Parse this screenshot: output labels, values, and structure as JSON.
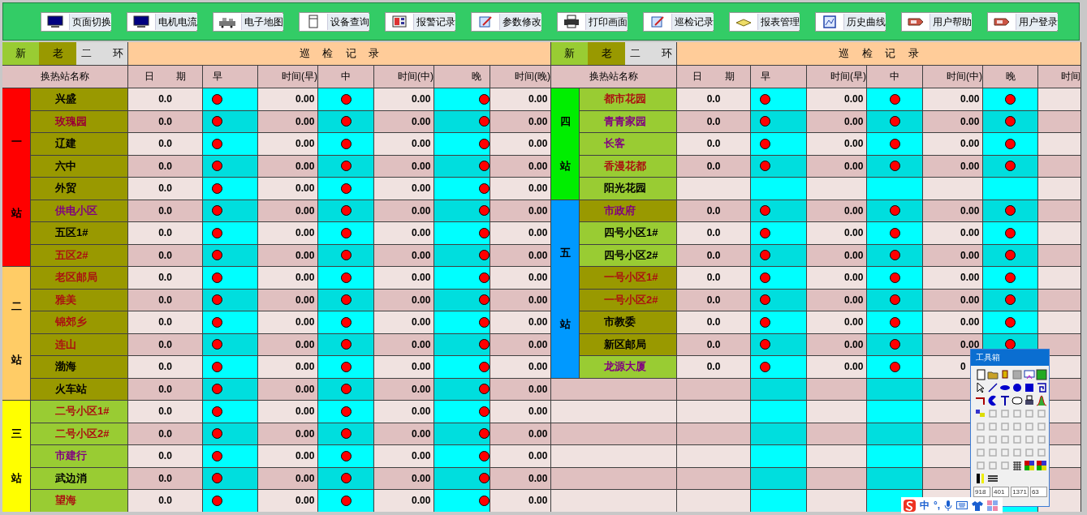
{
  "toolbar": {
    "buttons": [
      {
        "label": "页面切换"
      },
      {
        "label": "电机电流"
      },
      {
        "label": "电子地图"
      },
      {
        "label": "设备查询"
      },
      {
        "label": "报警记录"
      },
      {
        "label": "参数修改"
      },
      {
        "label": "打印画面"
      },
      {
        "label": "巡检记录"
      },
      {
        "label": "报表管理"
      },
      {
        "label": "历史曲线"
      },
      {
        "label": "用户帮助"
      },
      {
        "label": "用户登录"
      }
    ]
  },
  "panels": [
    {
      "tabs": [
        {
          "label": "新",
          "color": "#99cc33"
        },
        {
          "label": "老",
          "color": "#999900"
        },
        {
          "label": "二 环",
          "color": "#dcdcdc"
        }
      ],
      "title": "巡 检 记 录",
      "columns": [
        "换热站名称",
        "日 期",
        "早",
        "时间(早)",
        "中",
        "时间(中)",
        "晚",
        "时间(晚)"
      ],
      "groups": [
        {
          "kind": "station",
          "label": "一站",
          "color": "#ff0000",
          "rows": [
            {
              "name": "兴盛",
              "color": "#000000",
              "kind": "old",
              "date": "0.0",
              "times": [
                "0.00",
                "0.00",
                "0.00"
              ],
              "dots": [
                {
                  "color": "#ff0000"
                },
                {
                  "color": "#ff0000"
                },
                {
                  "color": "#ff0000"
                }
              ]
            },
            {
              "name": "玫瑰园",
              "color": "#990033",
              "kind": "old",
              "date": "0.0",
              "times": [
                "0.00",
                "0.00",
                "0.00"
              ],
              "dots": [
                {
                  "color": "#ff0000"
                },
                {
                  "color": "#ff0000"
                },
                {
                  "color": "#ff0000"
                }
              ]
            },
            {
              "name": "辽建",
              "color": "#000000",
              "kind": "old",
              "date": "0.0",
              "times": [
                "0.00",
                "0.00",
                "0.00"
              ],
              "dots": [
                {
                  "color": "#ff0000"
                },
                {
                  "color": "#ff0000"
                },
                {
                  "color": "#ff0000"
                }
              ]
            },
            {
              "name": "六中",
              "color": "#000000",
              "kind": "old",
              "date": "0.0",
              "times": [
                "0.00",
                "0.00",
                "0.00"
              ],
              "dots": [
                {
                  "color": "#ff0000"
                },
                {
                  "color": "#ff0000"
                },
                {
                  "color": "#ff0000"
                }
              ]
            },
            {
              "name": "外贸",
              "color": "#000000",
              "kind": "old",
              "date": "0.0",
              "times": [
                "0.00",
                "0.00",
                "0.00"
              ],
              "dots": [
                {
                  "color": "#ff0000"
                },
                {
                  "color": "#ff0000"
                },
                {
                  "color": "#ff0000"
                }
              ]
            },
            {
              "name": "供电小区",
              "color": "#800080",
              "kind": "old",
              "date": "0.0",
              "times": [
                "0.00",
                "0.00",
                "0.00"
              ],
              "dots": [
                {
                  "color": "#ff0000"
                },
                {
                  "color": "#ff0000"
                },
                {
                  "color": "#ff0000"
                }
              ]
            },
            {
              "name": "五区1#",
              "color": "#000000",
              "kind": "old",
              "date": "0.0",
              "times": [
                "0.00",
                "0.00",
                "0.00"
              ],
              "dots": [
                {
                  "color": "#ff0000"
                },
                {
                  "color": "#ff0000"
                },
                {
                  "color": "#ff0000"
                }
              ]
            },
            {
              "name": "五区2#",
              "color": "#aa1111",
              "kind": "old",
              "date": "0.0",
              "times": [
                "0.00",
                "0.00",
                "0.00"
              ],
              "dots": [
                {
                  "color": "#ff0000"
                },
                {
                  "color": "#ff0000"
                },
                {
                  "color": "#ff0000"
                }
              ]
            }
          ]
        },
        {
          "kind": "station",
          "label": "二站",
          "color": "#ffcc66",
          "rows": [
            {
              "name": "老区邮局",
              "color": "#aa1111",
              "kind": "old",
              "date": "0.0",
              "times": [
                "0.00",
                "0.00",
                "0.00"
              ],
              "dots": [
                {
                  "color": "#ff0000"
                },
                {
                  "color": "#ff0000"
                },
                {
                  "color": "#ff0000"
                }
              ]
            },
            {
              "name": "雅美",
              "color": "#aa1111",
              "kind": "old",
              "date": "0.0",
              "times": [
                "0.00",
                "0.00",
                "0.00"
              ],
              "dots": [
                {
                  "color": "#ff0000"
                },
                {
                  "color": "#ff0000"
                },
                {
                  "color": "#ff0000"
                }
              ]
            },
            {
              "name": "锦郊乡",
              "color": "#aa1111",
              "kind": "old",
              "date": "0.0",
              "times": [
                "0.00",
                "0.00",
                "0.00"
              ],
              "dots": [
                {
                  "color": "#ff0000"
                },
                {
                  "color": "#ff0000"
                },
                {
                  "color": "#ff0000"
                }
              ]
            },
            {
              "name": "连山",
              "color": "#aa1111",
              "kind": "old",
              "date": "0.0",
              "times": [
                "0.00",
                "0.00",
                "0.00"
              ],
              "dots": [
                {
                  "color": "#ff0000"
                },
                {
                  "color": "#ff0000"
                },
                {
                  "color": "#ff0000"
                }
              ]
            },
            {
              "name": "渤海",
              "color": "#000000",
              "kind": "old",
              "date": "0.0",
              "times": [
                "0.00",
                "0.00",
                "0.00"
              ],
              "dots": [
                {
                  "color": "#ff0000"
                },
                {
                  "color": "#ff0000"
                },
                {
                  "color": "#ff0000"
                }
              ]
            },
            {
              "name": "火车站",
              "color": "#000000",
              "kind": "old",
              "date": "0.0",
              "times": [
                "0.00",
                "0.00",
                "0.00"
              ],
              "dots": [
                {
                  "color": "#ff0000"
                },
                {
                  "color": "#ff0000"
                },
                {
                  "color": "#ff0000"
                }
              ]
            }
          ]
        },
        {
          "kind": "station",
          "label": "三站",
          "color": "#ffff00",
          "rows": [
            {
              "name": "二号小区1#",
              "color": "#aa1111",
              "kind": "new",
              "date": "0.0",
              "times": [
                "0.00",
                "0.00",
                "0.00"
              ],
              "dots": [
                {
                  "color": "#ff0000"
                },
                {
                  "color": "#ff0000"
                },
                {
                  "color": "#ff0000"
                }
              ]
            },
            {
              "name": "二号小区2#",
              "color": "#aa1111",
              "kind": "new",
              "date": "0.0",
              "times": [
                "0.00",
                "0.00",
                "0.00"
              ],
              "dots": [
                {
                  "color": "#ff0000"
                },
                {
                  "color": "#ff0000"
                },
                {
                  "color": "#ff0000"
                }
              ]
            },
            {
              "name": "市建行",
              "color": "#800080",
              "kind": "new",
              "date": "0.0",
              "times": [
                "0.00",
                "0.00",
                "0.00"
              ],
              "dots": [
                {
                  "color": "#ff0000"
                },
                {
                  "color": "#ff0000"
                },
                {
                  "color": "#ff0000"
                }
              ]
            },
            {
              "name": "武边消",
              "color": "#000000",
              "kind": "new",
              "date": "0.0",
              "times": [
                "0.00",
                "0.00",
                "0.00"
              ],
              "dots": [
                {
                  "color": "#ff0000"
                },
                {
                  "color": "#ff0000"
                },
                {
                  "color": "#ff0000"
                }
              ]
            },
            {
              "name": "望海",
              "color": "#aa1111",
              "kind": "new",
              "date": "0.0",
              "times": [
                "0.00",
                "0.00",
                "0.00"
              ],
              "dots": [
                {
                  "color": "#ff0000"
                },
                {
                  "color": "#ff0000"
                },
                {
                  "color": "#ff0000"
                }
              ]
            }
          ]
        }
      ]
    },
    {
      "tabs": [
        {
          "label": "新",
          "color": "#99cc33"
        },
        {
          "label": "老",
          "color": "#999900"
        },
        {
          "label": "二 环",
          "color": "#dcdcdc"
        }
      ],
      "title": "巡 检 记 录",
      "columns": [
        "换热站名称",
        "日 期",
        "早",
        "时间(早)",
        "中",
        "时间(中)",
        "晚",
        "时间"
      ],
      "groups": [
        {
          "kind": "station",
          "label": "四站",
          "color": "#00ee00",
          "rows": [
            {
              "name": "都市花园",
              "color": "#aa1111",
              "kind": "new",
              "date": "0.0",
              "times": [
                "0.00",
                "0.00"
              ],
              "dots": [
                {
                  "color": "#ff0000"
                },
                {
                  "color": "#ff0000"
                },
                {
                  "color": "#ff0000"
                }
              ]
            },
            {
              "name": "青青家园",
              "color": "#800080",
              "kind": "new",
              "date": "0.0",
              "times": [
                "0.00",
                "0.00"
              ],
              "dots": [
                {
                  "color": "#ff0000"
                },
                {
                  "color": "#ff0000"
                },
                {
                  "color": "#ff0000"
                }
              ]
            },
            {
              "name": "长客",
              "color": "#800080",
              "kind": "new",
              "date": "0.0",
              "times": [
                "0.00",
                "0.00"
              ],
              "dots": [
                {
                  "color": "#ff0000"
                },
                {
                  "color": "#ff0000"
                },
                {
                  "color": "#ff0000"
                }
              ]
            },
            {
              "name": "香漫花都",
              "color": "#aa1111",
              "kind": "new",
              "date": "0.0",
              "times": [
                "0.00",
                "0.00"
              ],
              "dots": [
                {
                  "color": "#ff0000"
                },
                {
                  "color": "#ff0000"
                },
                {
                  "color": "#ff0000"
                }
              ]
            },
            {
              "name": "阳光花园",
              "color": "#000000",
              "kind": "new"
            }
          ]
        },
        {
          "kind": "station",
          "label": "五站",
          "color": "#0099ff",
          "rows": [
            {
              "name": "市政府",
              "color": "#800080",
              "kind": "old",
              "date": "0.0",
              "times": [
                "0.00",
                "0.00"
              ],
              "dots": [
                {
                  "color": "#ff0000"
                },
                {
                  "color": "#ff0000"
                },
                {
                  "color": "#ff0000"
                }
              ]
            },
            {
              "name": "四号小区1#",
              "color": "#000000",
              "kind": "new",
              "date": "0.0",
              "times": [
                "0.00",
                "0.00"
              ],
              "dots": [
                {
                  "color": "#ff0000"
                },
                {
                  "color": "#ff0000"
                },
                {
                  "color": "#ff0000"
                }
              ]
            },
            {
              "name": "四号小区2#",
              "color": "#000000",
              "kind": "new",
              "date": "0.0",
              "times": [
                "0.00",
                "0.00"
              ],
              "dots": [
                {
                  "color": "#ff0000"
                },
                {
                  "color": "#ff0000"
                },
                {
                  "color": "#ff0000"
                }
              ]
            },
            {
              "name": "一号小区1#",
              "color": "#aa1111",
              "kind": "old",
              "date": "0.0",
              "times": [
                "0.00",
                "0.00"
              ],
              "dots": [
                {
                  "color": "#ff0000"
                },
                {
                  "color": "#ff0000"
                },
                {
                  "color": "#ff0000"
                }
              ]
            },
            {
              "name": "一号小区2#",
              "color": "#aa1111",
              "kind": "old",
              "date": "0.0",
              "times": [
                "0.00",
                "0.00"
              ],
              "dots": [
                {
                  "color": "#ff0000"
                },
                {
                  "color": "#ff0000"
                },
                {
                  "color": "#ff0000"
                }
              ]
            },
            {
              "name": "市教委",
              "color": "#000000",
              "kind": "old",
              "date": "0.0",
              "times": [
                "0.00",
                "0.00"
              ],
              "dots": [
                {
                  "color": "#ff0000"
                },
                {
                  "color": "#ff0000"
                },
                {
                  "color": "#ff0000"
                }
              ]
            },
            {
              "name": "新区邮局",
              "color": "#000000",
              "kind": "old",
              "date": "0.0",
              "times": [
                "0.00",
                "0.00"
              ],
              "dots": [
                {
                  "color": "#ff0000"
                },
                {
                  "color": "#ff0000"
                },
                {
                  "color": "#ff0000"
                }
              ]
            },
            {
              "name": "龙源大厦",
              "color": "#800080",
              "kind": "new",
              "date": "0.0",
              "times": [
                "0.00",
                "0"
              ],
              "dots": [
                {
                  "color": "#ff0000"
                },
                {
                  "color": "#ff0000"
                }
              ]
            }
          ]
        },
        {
          "kind": "blank",
          "rows": [
            {
              "kind": "blank"
            },
            {
              "kind": "blank"
            },
            {
              "kind": "blank"
            },
            {
              "kind": "blank"
            },
            {
              "kind": "blank"
            },
            {
              "kind": "blank"
            }
          ]
        }
      ]
    }
  ],
  "toolbox": {
    "title": "工具箱",
    "fields": [
      "918",
      "401",
      "1371",
      "63"
    ]
  },
  "ime": {
    "labels": [
      "中",
      "°,"
    ]
  }
}
